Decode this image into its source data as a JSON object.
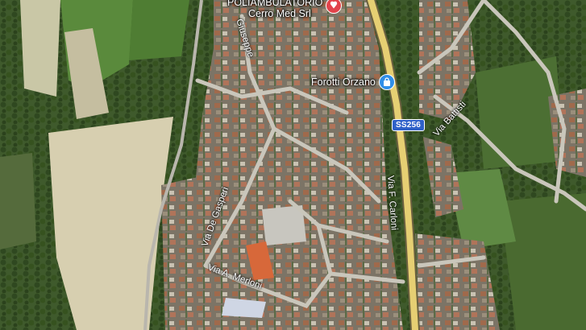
{
  "map": {
    "type": "satellite",
    "pois": [
      {
        "id": "clinic",
        "lines": [
          "POLIAMBULATORIO",
          "Cerro Med Srl"
        ],
        "icon": "medical-cross-icon",
        "color": "#e2434b"
      },
      {
        "id": "shop",
        "lines": [
          "Forotti Orzano"
        ],
        "icon": "shopping-bag-icon",
        "color": "#2f8ee8"
      }
    ],
    "road_shield": {
      "label": "SS256",
      "color": "#2f61c8"
    },
    "streets": [
      {
        "id": "giuseppe",
        "label": "Giuseppe"
      },
      {
        "id": "battisti",
        "label": "Via Battisti"
      },
      {
        "id": "carloni",
        "label": "Via F. Carloni"
      },
      {
        "id": "degasperi",
        "label": "Via De Gasperi"
      },
      {
        "id": "merloni",
        "label": "Via A. Merloni"
      }
    ],
    "colors": {
      "main_road": "#e6cf73",
      "pale_field": "#d7cfb0",
      "green_field": "#58853c"
    }
  }
}
